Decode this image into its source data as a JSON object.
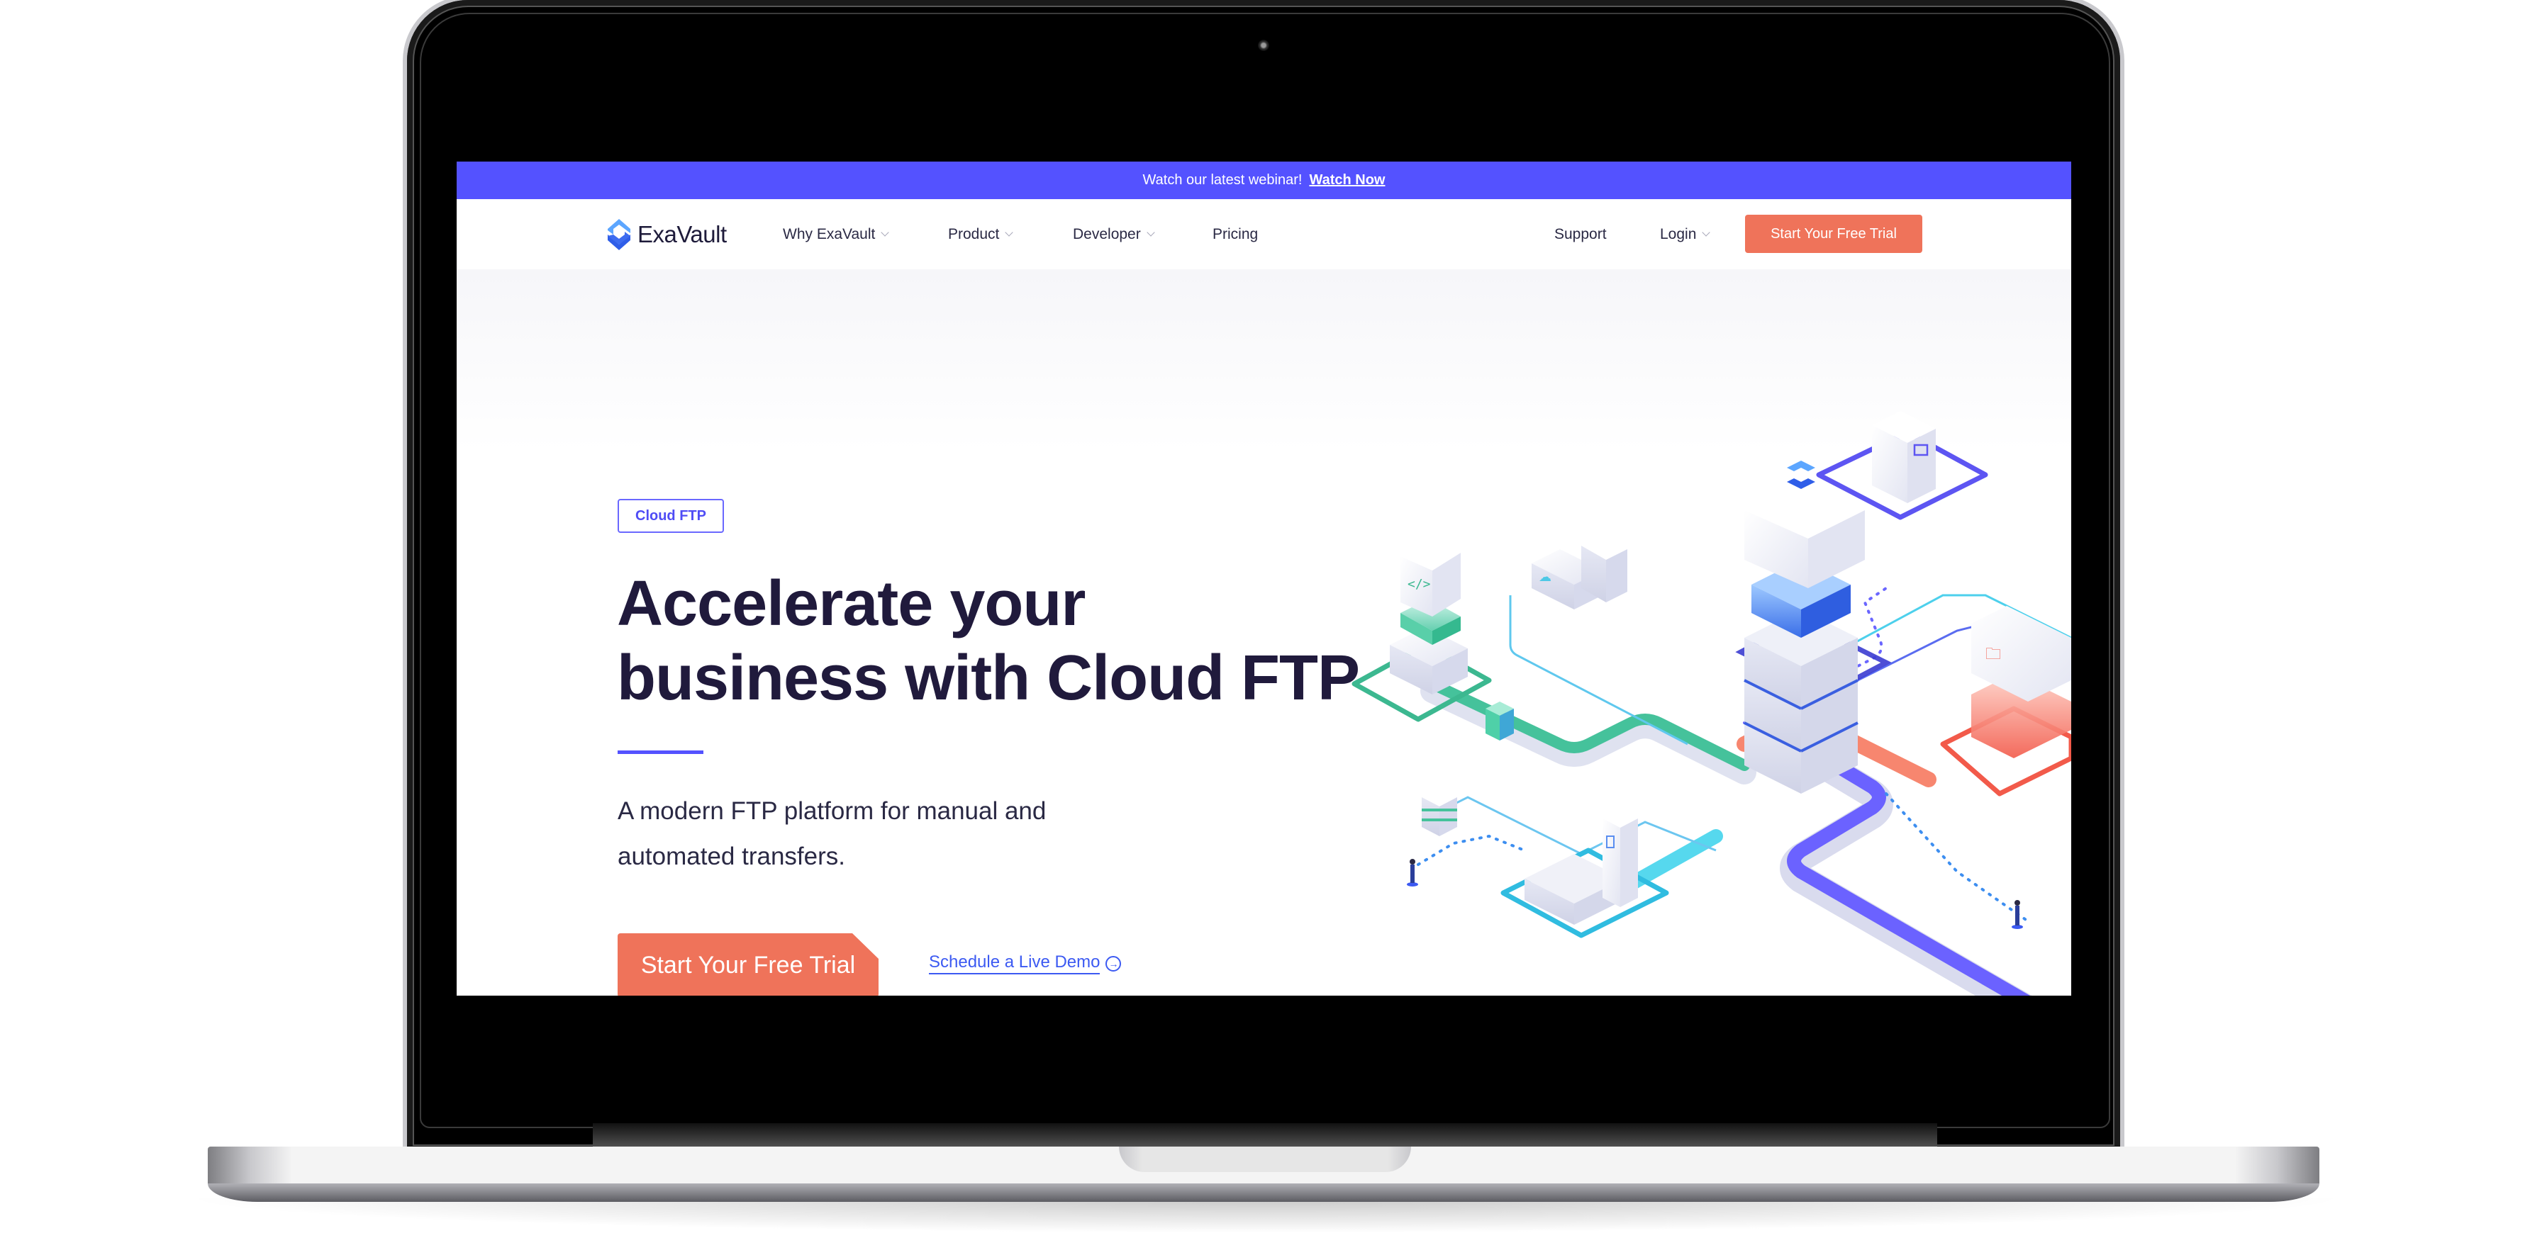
{
  "banner": {
    "text": "Watch our latest webinar!",
    "link_label": "Watch Now"
  },
  "nav": {
    "logo_text": "ExaVault",
    "items": [
      {
        "label": "Why ExaVault",
        "has_dropdown": true
      },
      {
        "label": "Product",
        "has_dropdown": true
      },
      {
        "label": "Developer",
        "has_dropdown": true
      },
      {
        "label": "Pricing",
        "has_dropdown": false
      }
    ],
    "right_items": [
      {
        "label": "Support",
        "has_dropdown": false
      },
      {
        "label": "Login",
        "has_dropdown": true
      }
    ],
    "cta_label": "Start Your Free Trial"
  },
  "hero": {
    "badge": "Cloud FTP",
    "headline_line1": "Accelerate your",
    "headline_line2": "business with Cloud FTP",
    "subtitle_line1": "A modern FTP platform for manual and",
    "subtitle_line2": "automated transfers.",
    "primary_cta": "Start Your Free Trial",
    "secondary_cta": "Schedule a Live Demo"
  },
  "colors": {
    "brand_primary": "#5452ff",
    "cta_coral": "#ef735a",
    "heading_dark": "#201a3c",
    "link_blue": "#3c5af2"
  },
  "illustration": {
    "description": "isometric network of servers connected by colored pipelines",
    "node_icons": [
      "code-icon",
      "cloud-icon",
      "exavault-logo-icon",
      "monitor-icon",
      "folder-icon",
      "document-icon"
    ]
  }
}
